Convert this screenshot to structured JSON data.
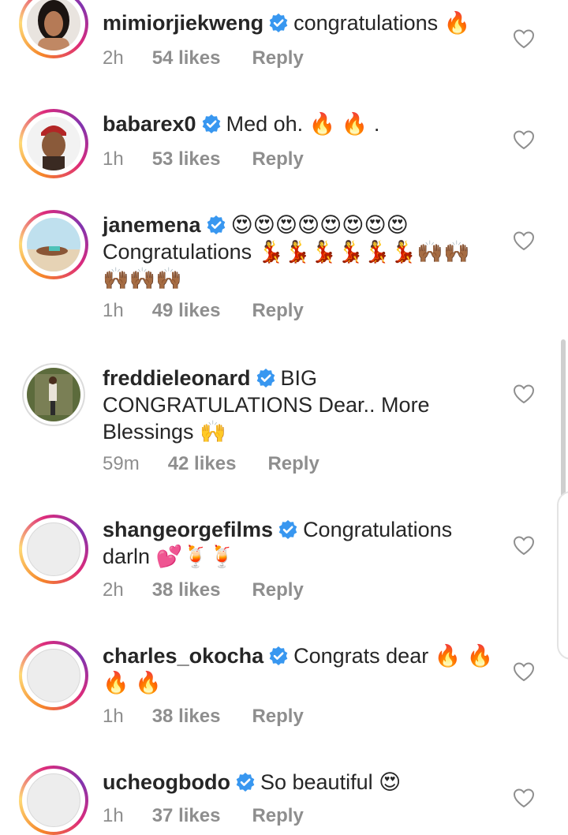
{
  "comments": [
    {
      "username": "mimiorjiekweng",
      "text": "congratulations 🔥",
      "time": "2h",
      "likes": "54 likes",
      "reply": "Reply",
      "avatar": "photo-woman-portrait",
      "ring": "story"
    },
    {
      "username": "babarex0",
      "text": "Med oh. 🔥 🔥 .",
      "time": "1h",
      "likes": "53 likes",
      "reply": "Reply",
      "avatar": "photo-man-red-cap",
      "ring": "story"
    },
    {
      "username": "janemena",
      "text": "😍😍😍😍😍😍😍😍 Congratulations 💃💃💃💃💃💃🙌🏾🙌🏾 🙌🏾🙌🏾🙌🏾",
      "time": "1h",
      "likes": "49 likes",
      "reply": "Reply",
      "avatar": "photo-woman-beach",
      "ring": "story"
    },
    {
      "username": "freddieleonard",
      "text": "BIG CONGRATULATIONS Dear.. More Blessings 🙌",
      "time": "59m",
      "likes": "42 likes",
      "reply": "Reply",
      "avatar": "photo-man-forest",
      "ring": "none"
    },
    {
      "username": "shangeorgefilms",
      "text": "Congratulations darln 💕🍹🍹",
      "time": "2h",
      "likes": "38 likes",
      "reply": "Reply",
      "avatar": "placeholder",
      "ring": "story"
    },
    {
      "username": "charles_okocha",
      "text": "Congrats dear 🔥 🔥 🔥 🔥",
      "time": "1h",
      "likes": "38 likes",
      "reply": "Reply",
      "avatar": "placeholder",
      "ring": "story"
    },
    {
      "username": "ucheogbodo",
      "text": "So beautiful 😍",
      "time": "1h",
      "likes": "37 likes",
      "reply": "Reply",
      "avatar": "placeholder",
      "ring": "story"
    }
  ],
  "icons": {
    "verified": "verified-badge-icon",
    "like": "heart-outline-icon"
  },
  "colors": {
    "verified_blue": "#3897f0",
    "meta_gray": "#8e8e8e",
    "text": "#262626"
  }
}
